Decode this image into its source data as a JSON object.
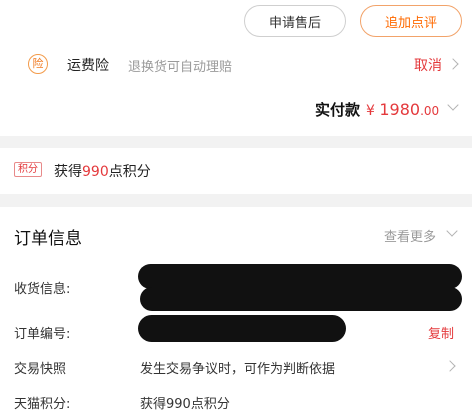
{
  "actions": {
    "after_sale_label": "申请售后",
    "add_review_label": "追加点评"
  },
  "insurance": {
    "icon_char": "险",
    "title": "运费险",
    "description": "退换货可自动理赔",
    "cancel_label": "取消"
  },
  "payment": {
    "label": "实付款",
    "currency": "¥",
    "amount_int": "1980",
    "amount_dec": ".00"
  },
  "points_banner": {
    "badge": "积分",
    "prefix": "获得",
    "points": "990",
    "suffix": "点积分"
  },
  "order_info": {
    "title": "订单信息",
    "more_label": "查看更多",
    "rows": {
      "shipping_label": "收货信息:",
      "order_no_label": "订单编号:",
      "copy_label": "复制",
      "snapshot_label": "交易快照",
      "snapshot_value": "发生交易争议时，可作为判断依据",
      "tmall_points_label": "天猫积分:",
      "tmall_points_value": "获得990点积分"
    }
  },
  "colors": {
    "accent_red": "#e4393c",
    "accent_orange": "#ff6a00",
    "muted_text": "#9a9a9a",
    "page_bg": "#f2f2f2"
  }
}
